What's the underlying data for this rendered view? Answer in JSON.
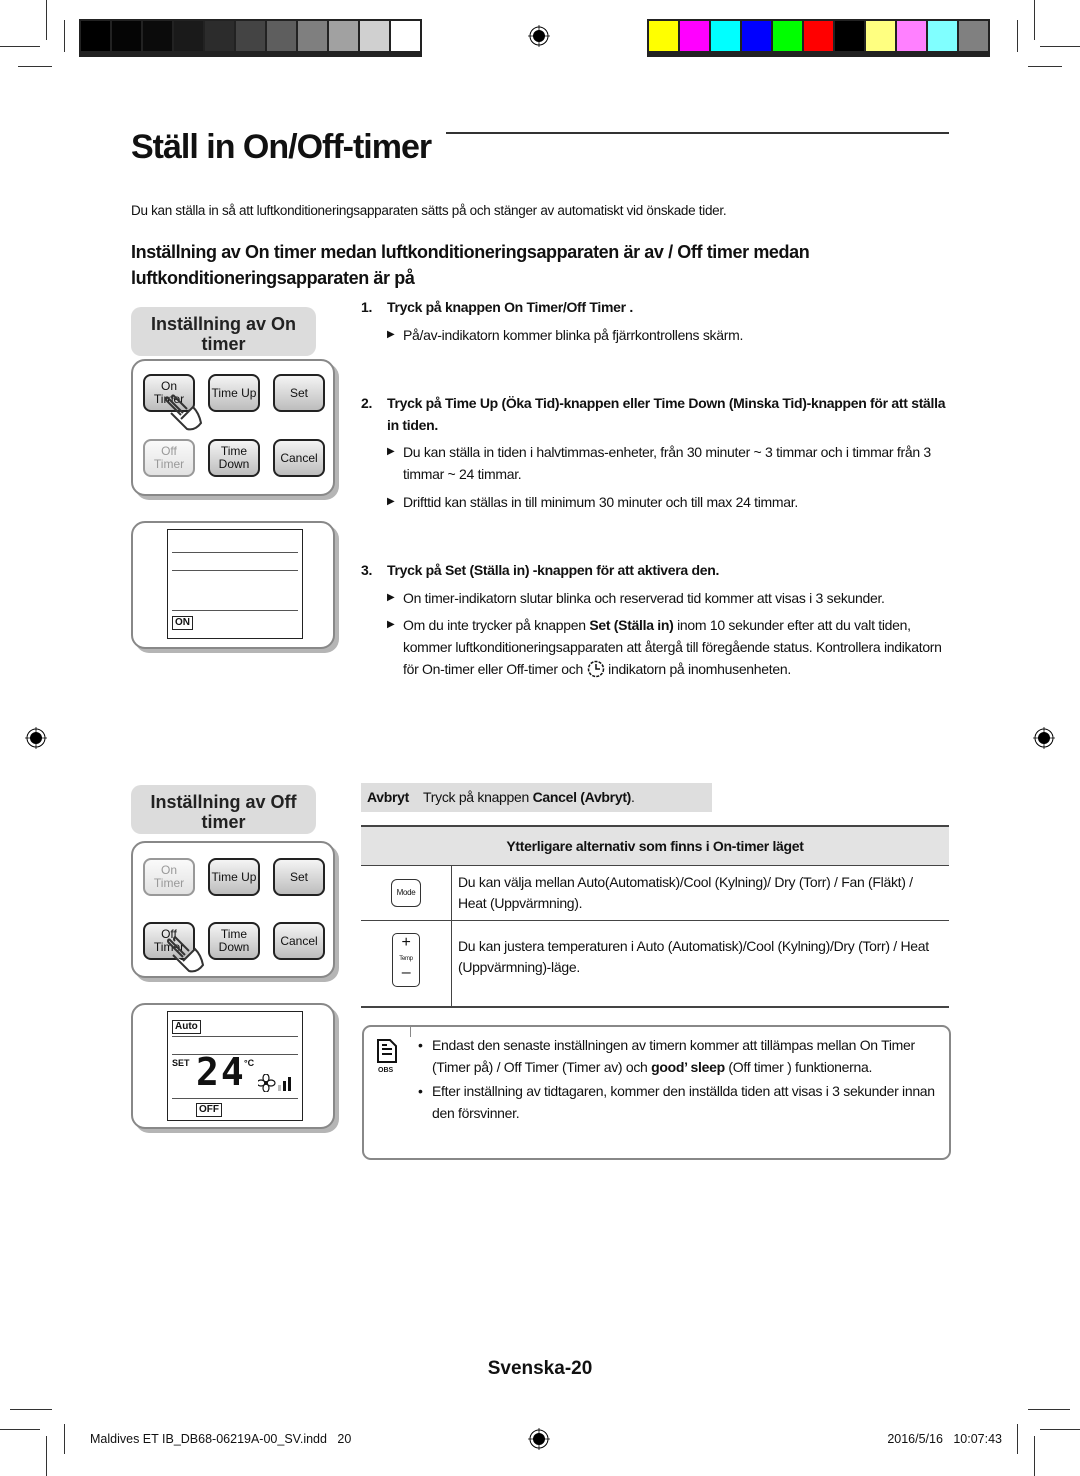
{
  "color_bars": {
    "grayscale": [
      "#000000",
      "#050505",
      "#0b0b0b",
      "#1a1a1a",
      "#2c2c2c",
      "#444444",
      "#5e5e5e",
      "#7f7f7f",
      "#a1a1a1",
      "#d0d0d0",
      "#ffffff"
    ],
    "process": [
      "#ffff00",
      "#ff00ff",
      "#00ffff",
      "#0000ff",
      "#00ff00",
      "#ff0000",
      "#000000",
      "#ffff80",
      "#ff80ff",
      "#80ffff",
      "#808080"
    ]
  },
  "page": {
    "title": "Ställ in On/Off-timer",
    "intro": "Du kan ställa in så att luftkonditioneringsapparaten sätts på och stänger av automatiskt vid önskade tider.",
    "section_heading": "Inställning av On timer medan luftkonditioneringsapparaten är av / Off timer medan luftkonditioneringsapparaten är på"
  },
  "on_panel": {
    "label": "Inställning av On timer",
    "buttons": {
      "on_timer": "On Timer",
      "time_up": "Time Up",
      "set": "Set",
      "off_timer": "Off Timer",
      "time_down": "Time Down",
      "cancel": "Cancel"
    },
    "display_badge": "ON"
  },
  "off_panel": {
    "label": "Inställning av Off timer",
    "buttons": {
      "on_timer": "On Timer",
      "time_up": "Time Up",
      "set": "Set",
      "off_timer": "Off Timer",
      "time_down": "Time Down",
      "cancel": "Cancel"
    },
    "display": {
      "mode_badge": "Auto",
      "set_label": "SET",
      "temperature": "24",
      "unit": "°C",
      "off_badge": "OFF"
    }
  },
  "steps": [
    {
      "num": "1.",
      "head_plain": "Tryck på knappen ",
      "head_bold": "On Timer/Off Timer .",
      "bullets": [
        "På/av-indikatorn kommer blinka på fjärrkontrollens skärm."
      ]
    },
    {
      "num": "2.",
      "head_a": "Tryck på ",
      "head_b": "Time Up (Öka Tid)",
      "head_c": "-knappen eller ",
      "head_d": "Time Down (Minska Tid)",
      "head_e": "-knappen  för att ställa in tiden.",
      "bullets": [
        "Du kan ställa in tiden i halvtimmas-enheter, från 30 minuter ~ 3 timmar och i timmar från 3 timmar ~ 24 timmar.",
        "Drifttid kan ställas in till minimum 30 minuter och till max 24 timmar."
      ]
    },
    {
      "num": "3.",
      "head_a": "Tryck på ",
      "head_b": "Set (Ställa in)",
      "head_c": " -knappen för att aktivera den.",
      "bullets": [
        "On timer-indikatorn slutar blinka och reserverad tid kommer att visas i 3 sekunder."
      ],
      "bullet2_a": "Om du inte trycker på knappen ",
      "bullet2_b": "Set (Ställa in)",
      "bullet2_c": " inom 10 sekunder efter att du valt tiden, kommer luftkonditioneringsapparaten  att återgå till föregående status. Kontrollera indikatorn för On-timer eller Off-timer och ",
      "bullet2_d": " indikatorn på inomhusenheten."
    }
  ],
  "cancel": {
    "label": "Avbryt",
    "text_plain": "Tryck på knappen ",
    "text_bold": "Cancel (Avbryt)",
    "text_end": "."
  },
  "options_table": {
    "header": "Ytterligare alternativ som finns i On-timer läget",
    "rows": [
      {
        "button": "Mode",
        "text": "Du kan välja mellan Auto(Automatisk)/Cool (Kylning)/ Dry (Torr) / Fan (Fläkt) / Heat (Uppvärmning)."
      },
      {
        "button": "Temp",
        "text": "Du kan justera temperaturen i Auto (Automatisk)/Cool (Kylning)/Dry (Torr) / Heat (Uppvärmning)-läge."
      }
    ]
  },
  "note": {
    "icon_label": "OBS",
    "item1_a": "Endast den senaste inställningen av timern kommer att tillämpas mellan On Timer (Timer på) / Off Timer (Timer av) och ",
    "item1_b": "good’ sleep",
    "item1_c": " (Off timer ) funktionerna.",
    "item2": "Efter inställning av tidtagaren, kommer den inställda tiden att visas i 3 sekunder innan den försvinner."
  },
  "footer": {
    "page_number": "Svenska-20",
    "file": "Maldives ET IB_DB68-06219A-00_SV.indd   20",
    "datetime": "2016/5/16   10:07:43"
  }
}
